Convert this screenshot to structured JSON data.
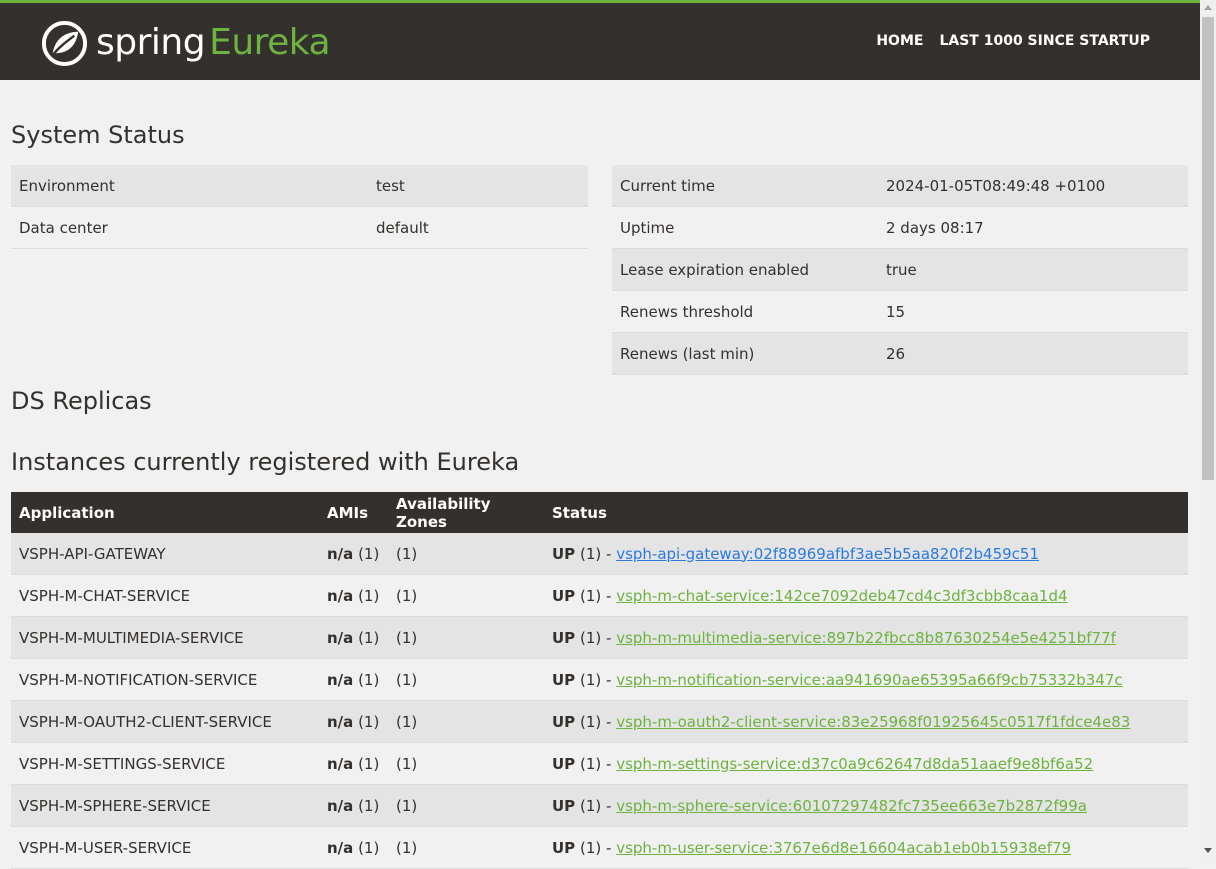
{
  "header": {
    "logo_word": "spring",
    "logo_product": "Eureka",
    "nav": [
      "HOME",
      "LAST 1000 SINCE STARTUP"
    ],
    "accent_color": "#6db33f",
    "bar_color": "#34302d"
  },
  "system_status": {
    "title": "System Status",
    "left": [
      {
        "label": "Environment",
        "value": "test"
      },
      {
        "label": "Data center",
        "value": "default"
      }
    ],
    "right": [
      {
        "label": "Current time",
        "value": "2024-01-05T08:49:48 +0100"
      },
      {
        "label": "Uptime",
        "value": "2 days 08:17"
      },
      {
        "label": "Lease expiration enabled",
        "value": "true"
      },
      {
        "label": "Renews threshold",
        "value": "15"
      },
      {
        "label": "Renews (last min)",
        "value": "26"
      }
    ]
  },
  "ds_replicas": {
    "title": "DS Replicas"
  },
  "instances": {
    "title": "Instances currently registered with Eureka",
    "headers": [
      "Application",
      "AMIs",
      "Availability Zones",
      "Status"
    ],
    "rows": [
      {
        "app": "VSPH-API-GATEWAY",
        "ami": "n/a",
        "ami_count": "(1)",
        "az": "(1)",
        "status": "UP",
        "status_count": "(1) -",
        "link": "vsph-api-gateway:02f88969afbf3ae5b5aa820f2b459c51"
      },
      {
        "app": "VSPH-M-CHAT-SERVICE",
        "ami": "n/a",
        "ami_count": "(1)",
        "az": "(1)",
        "status": "UP",
        "status_count": "(1) -",
        "link": "vsph-m-chat-service:142ce7092deb47cd4c3df3cbb8caa1d4"
      },
      {
        "app": "VSPH-M-MULTIMEDIA-SERVICE",
        "ami": "n/a",
        "ami_count": "(1)",
        "az": "(1)",
        "status": "UP",
        "status_count": "(1) -",
        "link": "vsph-m-multimedia-service:897b22fbcc8b87630254e5e4251bf77f"
      },
      {
        "app": "VSPH-M-NOTIFICATION-SERVICE",
        "ami": "n/a",
        "ami_count": "(1)",
        "az": "(1)",
        "status": "UP",
        "status_count": "(1) -",
        "link": "vsph-m-notification-service:aa941690ae65395a66f9cb75332b347c"
      },
      {
        "app": "VSPH-M-OAUTH2-CLIENT-SERVICE",
        "ami": "n/a",
        "ami_count": "(1)",
        "az": "(1)",
        "status": "UP",
        "status_count": "(1) -",
        "link": "vsph-m-oauth2-client-service:83e25968f01925645c0517f1fdce4e83"
      },
      {
        "app": "VSPH-M-SETTINGS-SERVICE",
        "ami": "n/a",
        "ami_count": "(1)",
        "az": "(1)",
        "status": "UP",
        "status_count": "(1) -",
        "link": "vsph-m-settings-service:d37c0a9c62647d8da51aaef9e8bf6a52"
      },
      {
        "app": "VSPH-M-SPHERE-SERVICE",
        "ami": "n/a",
        "ami_count": "(1)",
        "az": "(1)",
        "status": "UP",
        "status_count": "(1) -",
        "link": "vsph-m-sphere-service:60107297482fc735ee663e7b2872f99a"
      },
      {
        "app": "VSPH-M-USER-SERVICE",
        "ami": "n/a",
        "ami_count": "(1)",
        "az": "(1)",
        "status": "UP",
        "status_count": "(1) -",
        "link": "vsph-m-user-service:3767e6d8e16604acab1eb0b15938ef79"
      }
    ]
  }
}
